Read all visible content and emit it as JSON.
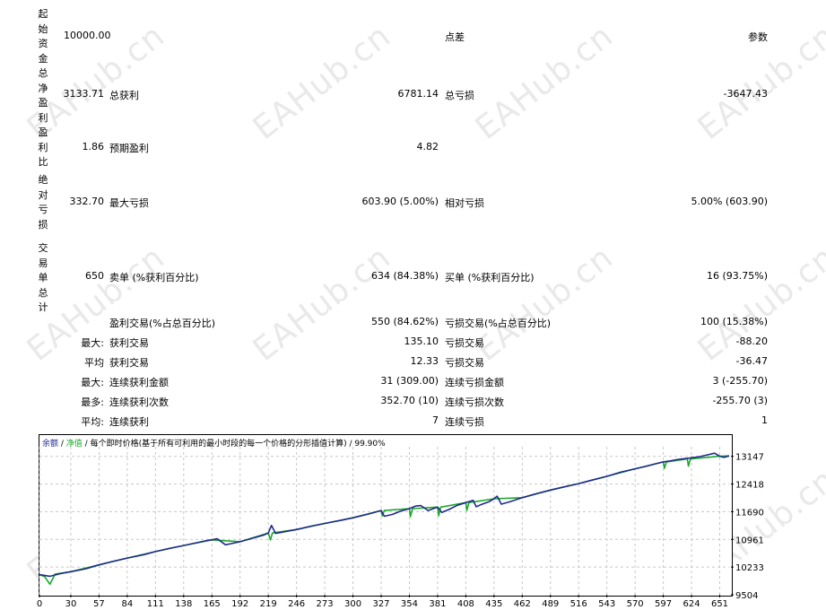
{
  "watermark": "EAHub.cn",
  "summary": {
    "initial_deposit": {
      "label_chars": [
        "起",
        "始",
        "资",
        "金"
      ],
      "value": "10000.00"
    },
    "spread_label": "点差",
    "params_label": "参数",
    "net_profit": {
      "label_chars": [
        "总",
        "净",
        "盈",
        "利"
      ],
      "value": "3133.71"
    },
    "gross_profit_label": "总获利",
    "gross_profit": "6781.14",
    "gross_loss_label": "总亏损",
    "gross_loss": "-3647.43",
    "profit_factor": {
      "label_chars": [
        "盈",
        "利",
        "比"
      ],
      "value": "1.86"
    },
    "expected_payoff_label": "预期盈利",
    "expected_payoff": "4.82",
    "absolute_drawdown": {
      "label_chars": [
        "绝",
        "对",
        "亏",
        "损"
      ],
      "value": "332.70"
    },
    "max_drawdown_label": "最大亏损",
    "max_drawdown": "603.90 (5.00%)",
    "relative_drawdown_label": "相对亏损",
    "relative_drawdown": "5.00% (603.90)",
    "total_trades": {
      "label_chars": [
        "交",
        "易",
        "单",
        "总",
        "计"
      ],
      "value": "650"
    },
    "short_label": "卖单 (%获利百分比)",
    "short_value": "634 (84.38%)",
    "long_label": "买单 (%获利百分比)",
    "long_value": "16 (93.75%)"
  },
  "rows": [
    {
      "prefix": "",
      "l_label": "盈利交易(%占总百分比)",
      "l_value": "550 (84.62%)",
      "r_label": "亏损交易(%占总百分比)",
      "r_value": "100 (15.38%)"
    },
    {
      "prefix": "最大:",
      "l_label": "获利交易",
      "l_value": "135.10",
      "r_label": "亏损交易",
      "r_value": "-88.20"
    },
    {
      "prefix": "平均",
      "l_label": "获利交易",
      "l_value": "12.33",
      "r_label": "亏损交易",
      "r_value": "-36.47"
    },
    {
      "prefix": "最大:",
      "l_label": "连续获利金额",
      "l_value": "31 (309.00)",
      "r_label": "连续亏损金额",
      "r_value": "3 (-255.70)"
    },
    {
      "prefix": "最多:",
      "l_label": "连续获利次数",
      "l_value": "352.70 (10)",
      "r_label": "连续亏损次数",
      "r_value": "-255.70 (3)"
    },
    {
      "prefix": "平均:",
      "l_label": "连续获利",
      "l_value": "7",
      "r_label": "连续亏损",
      "r_value": "1"
    }
  ],
  "chart_header": {
    "balance": "余额",
    "sep1": " / ",
    "equity": "净值",
    "sep2": " / ",
    "desc": "每个即时价格(基于所有可利用的最小时段的每一个价格的分形插值计算) / 99.90%"
  },
  "chart_data": {
    "type": "line",
    "title": "",
    "xlabel": "",
    "ylabel": "",
    "x_ticks": [
      0,
      30,
      57,
      84,
      111,
      138,
      165,
      192,
      219,
      246,
      273,
      300,
      327,
      354,
      381,
      408,
      435,
      462,
      489,
      516,
      543,
      570,
      597,
      624,
      651
    ],
    "y_ticks": [
      9504,
      10233,
      10961,
      11690,
      12418,
      13147
    ],
    "xlim": [
      0,
      660
    ],
    "ylim": [
      9504,
      13400
    ],
    "grid": true,
    "colors": {
      "balance": "#1f2a8c",
      "equity": "#1aa82a",
      "grid": "#c8c8c8"
    },
    "series": [
      {
        "name": "余额",
        "x": [
          0,
          10,
          20,
          30,
          45,
          57,
          70,
          84,
          100,
          111,
          125,
          138,
          150,
          160,
          165,
          170,
          178,
          185,
          192,
          205,
          215,
          219,
          222,
          226,
          232,
          246,
          260,
          273,
          290,
          300,
          315,
          327,
          330,
          338,
          345,
          354,
          360,
          365,
          372,
          381,
          385,
          392,
          400,
          408,
          415,
          418,
          422,
          430,
          435,
          438,
          442,
          450,
          462,
          475,
          489,
          500,
          516,
          530,
          543,
          556,
          570,
          580,
          588,
          597,
          602,
          610,
          624,
          632,
          640,
          646,
          651,
          655,
          660
        ],
        "values": [
          10033,
          9990,
          10060,
          10110,
          10190,
          10290,
          10380,
          10470,
          10560,
          10640,
          10730,
          10800,
          10870,
          10930,
          10950,
          10980,
          10820,
          10860,
          10900,
          11000,
          11080,
          11130,
          11330,
          11120,
          11150,
          11220,
          11310,
          11380,
          11470,
          11530,
          11630,
          11720,
          11570,
          11620,
          11700,
          11770,
          11840,
          11850,
          11720,
          11810,
          11670,
          11750,
          11860,
          11930,
          11990,
          11820,
          11870,
          11950,
          12030,
          12100,
          11890,
          11950,
          12060,
          12160,
          12260,
          12330,
          12430,
          12530,
          12620,
          12730,
          12820,
          12880,
          12940,
          13000,
          13020,
          13060,
          13110,
          13140,
          13190,
          13230,
          13150,
          13120,
          13160
        ]
      },
      {
        "name": "净值",
        "x": [
          0,
          5,
          10,
          15,
          30,
          57,
          84,
          111,
          138,
          165,
          192,
          219,
          221,
          223,
          246,
          273,
          300,
          327,
          328,
          330,
          354,
          355,
          357,
          381,
          382,
          384,
          408,
          409,
          411,
          435,
          462,
          489,
          516,
          543,
          570,
          597,
          598,
          600,
          620,
          621,
          623,
          651,
          660
        ],
        "values": [
          10033,
          9980,
          9780,
          10050,
          10110,
          10290,
          10470,
          10640,
          10800,
          10950,
          10900,
          11130,
          10950,
          11130,
          11220,
          11380,
          11530,
          11720,
          11580,
          11720,
          11770,
          11560,
          11770,
          11810,
          11580,
          11810,
          11930,
          11720,
          11930,
          12030,
          12060,
          12260,
          12430,
          12620,
          12820,
          13000,
          12830,
          13000,
          13080,
          12890,
          13080,
          13150,
          13160
        ]
      }
    ]
  }
}
